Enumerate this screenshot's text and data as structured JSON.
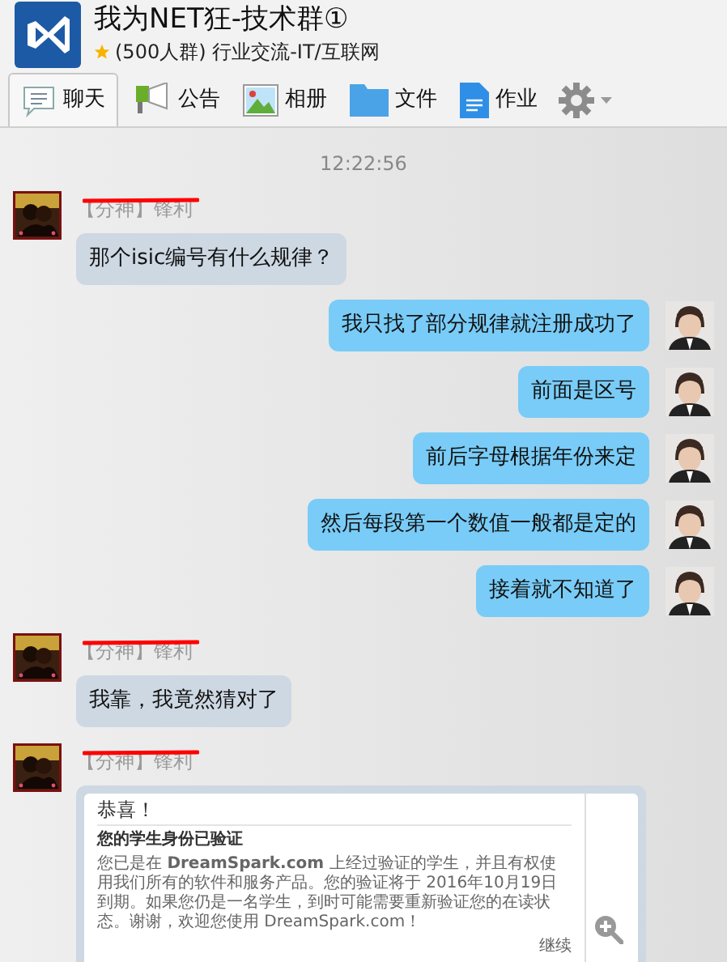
{
  "header": {
    "title": "我为NET狂-技术群①",
    "subtitle": "(500人群) 行业交流-IT/互联网"
  },
  "tabs": [
    {
      "label": "聊天",
      "selected": true
    },
    {
      "label": "公告",
      "selected": false
    },
    {
      "label": "相册",
      "selected": false
    },
    {
      "label": "文件",
      "selected": false
    },
    {
      "label": "作业",
      "selected": false
    }
  ],
  "timestamp": "12:22:56",
  "messages": [
    {
      "kind": "received",
      "sender": "【分神】锋利",
      "text": "那个isic编号有什么规律？"
    },
    {
      "kind": "sent",
      "text": "我只找了部分规律就注册成功了"
    },
    {
      "kind": "sent",
      "text": "前面是区号"
    },
    {
      "kind": "sent",
      "text": "前后字母根据年份来定"
    },
    {
      "kind": "sent",
      "text": "然后每段第一个数值一般都是定的"
    },
    {
      "kind": "sent",
      "text": "接着就不知道了"
    },
    {
      "kind": "received",
      "sender": "【分神】锋利",
      "text": "我靠，我竟然猜对了"
    },
    {
      "kind": "received_image",
      "sender": "【分神】锋利",
      "card": {
        "title": "恭喜！",
        "heading": "您的学生身份已验证",
        "body": "您已是在 **DreamSpark.com** 上经过验证的学生，并且有权使用我们所有的软件和服务产品。您的验证将于 2016年10月19日到期。如果您仍是一名学生，到时可能需要重新验证您的在读状态。谢谢，欢迎您使用 DreamSpark.com！",
        "link": "继续"
      }
    }
  ]
}
